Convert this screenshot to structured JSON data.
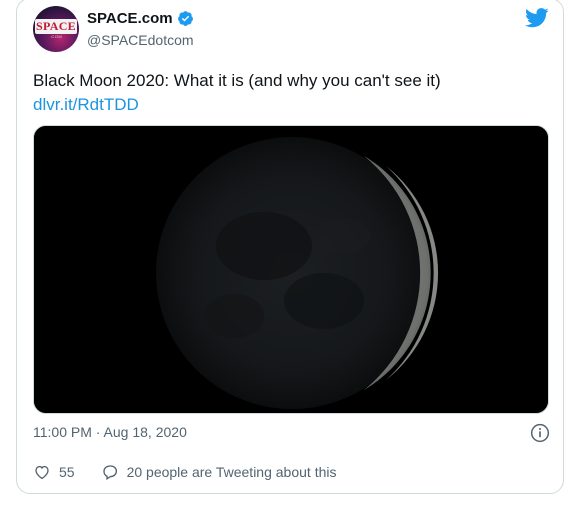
{
  "author": {
    "display_name": "SPACE.com",
    "handle": "@SPACEdotcom",
    "avatar_logo": "SPACE",
    "avatar_logo_sub": ".COM",
    "verified_icon": "verified-badge-icon"
  },
  "tweet": {
    "text": "Black Moon 2020: What it is (and why you can't see it)",
    "link": "dlvr.it/RdtTDD",
    "timestamp": "11:00 PM · Aug 18, 2020"
  },
  "media": {
    "icon": "moon-image"
  },
  "actions": {
    "likes_count": "55",
    "conversation_label": "20 people are Tweeting about this"
  },
  "colors": {
    "brand_blue": "#1d9bf0",
    "link_blue": "#1b95e0",
    "muted_text": "#536471",
    "body_text": "#0f1419",
    "border": "#cfd9de"
  }
}
